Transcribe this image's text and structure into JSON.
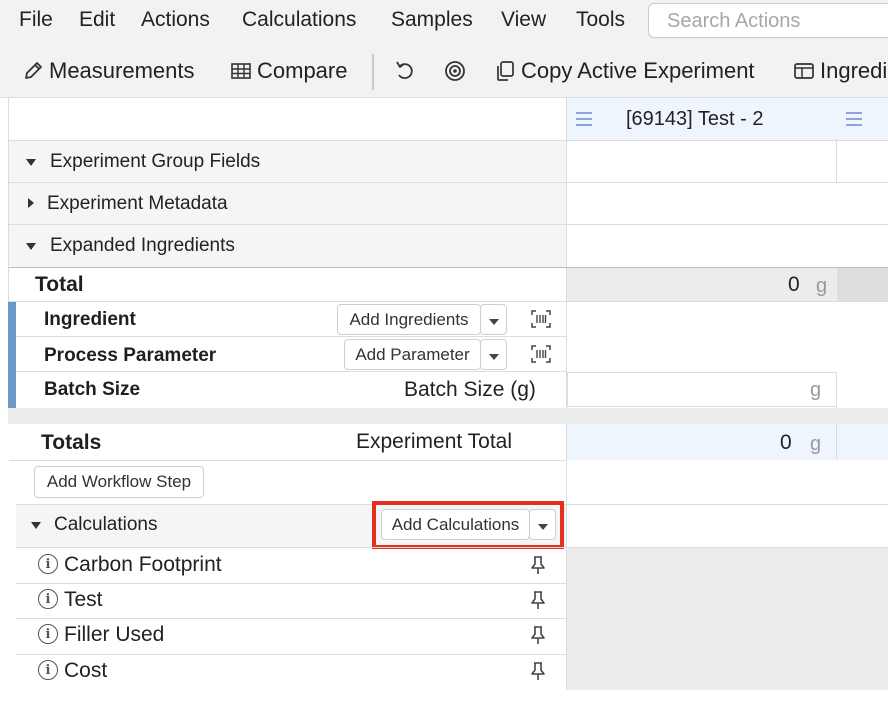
{
  "menu": {
    "items": [
      "File",
      "Edit",
      "Actions",
      "Calculations",
      "Samples",
      "View",
      "Tools"
    ],
    "search_placeholder": "Search Actions"
  },
  "toolbar": {
    "measurements": "Measurements",
    "compare": "Compare",
    "copy_experiment": "Copy Active Experiment",
    "ingredients": "Ingredi"
  },
  "experiment": {
    "header": "[69143] Test - 2"
  },
  "sections": {
    "group_fields": "Experiment Group Fields",
    "metadata": "Experiment Metadata",
    "expanded_ingredients": "Expanded Ingredients"
  },
  "table": {
    "total_label": "Total",
    "total_value": "0",
    "unit_g": "g",
    "ingredient_label": "Ingredient",
    "add_ingredients": "Add Ingredients",
    "process_parameter_label": "Process Parameter",
    "add_parameter": "Add Parameter",
    "batch_size_label": "Batch Size",
    "batch_size_unit_label": "Batch Size (g)",
    "totals_label": "Totals",
    "experiment_total_label": "Experiment Total",
    "experiment_total_value": "0"
  },
  "workflow": {
    "add_step": "Add Workflow Step"
  },
  "calculations": {
    "title": "Calculations",
    "add_button": "Add Calculations",
    "items": [
      "Carbon Footprint",
      "Test",
      "Filler Used",
      "Cost"
    ]
  },
  "colors": {
    "highlight": "#e5301e",
    "accent_blue": "#6d98c8",
    "header_blue": "#eef5fd"
  }
}
